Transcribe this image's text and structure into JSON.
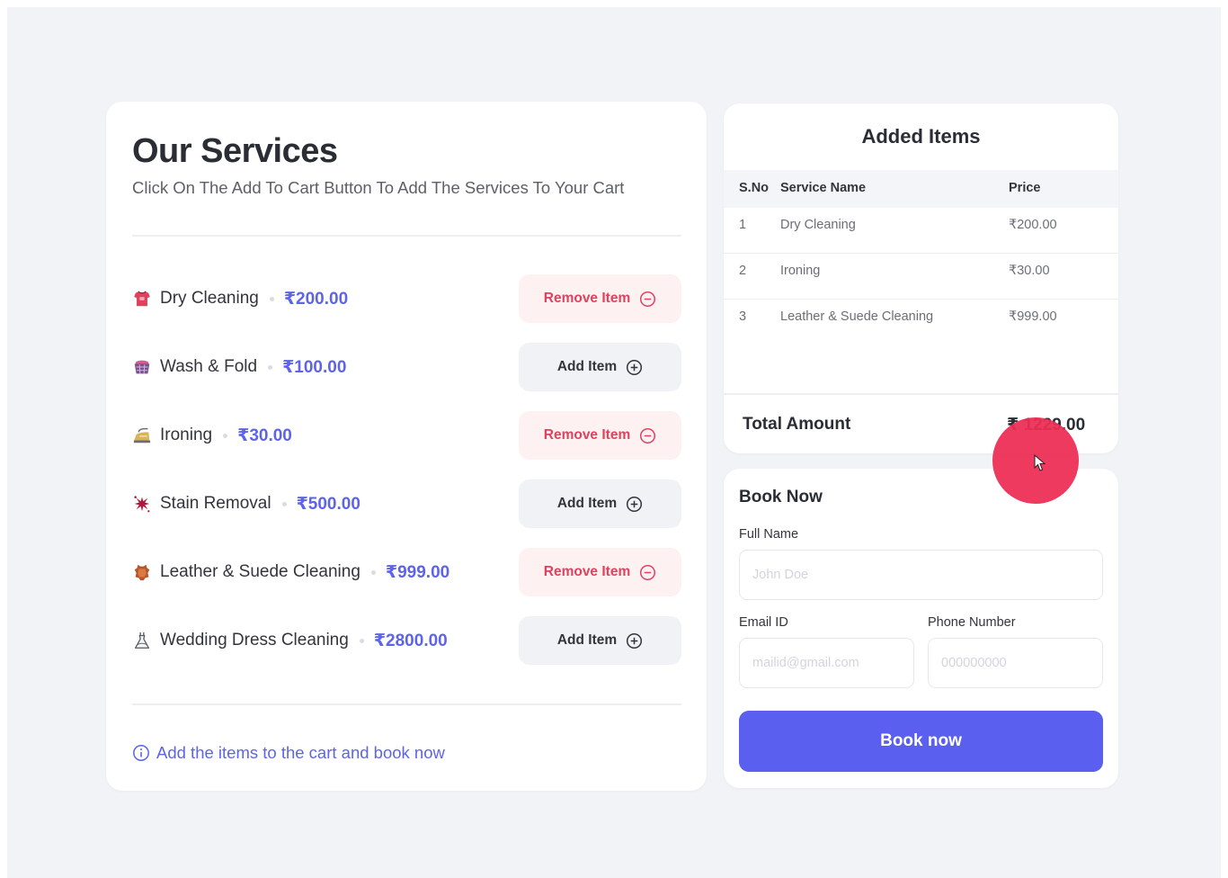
{
  "services": {
    "title": "Our Services",
    "subtitle": "Click On The Add To Cart Button To Add The Services To Your Cart",
    "items": [
      {
        "icon": "shirt-icon",
        "name": "Dry Cleaning",
        "price": "₹200.00",
        "action": "Remove Item",
        "state": "remove"
      },
      {
        "icon": "laundry-basket-icon",
        "name": "Wash & Fold",
        "price": "₹100.00",
        "action": "Add Item",
        "state": "add"
      },
      {
        "icon": "iron-icon",
        "name": "Ironing",
        "price": "₹30.00",
        "action": "Remove Item",
        "state": "remove"
      },
      {
        "icon": "stain-splat-icon",
        "name": "Stain Removal",
        "price": "₹500.00",
        "action": "Add Item",
        "state": "add"
      },
      {
        "icon": "leather-hide-icon",
        "name": "Leather & Suede Cleaning",
        "price": "₹999.00",
        "action": "Remove Item",
        "state": "remove"
      },
      {
        "icon": "wedding-dress-icon",
        "name": "Wedding Dress Cleaning",
        "price": "₹2800.00",
        "action": "Add Item",
        "state": "add"
      }
    ],
    "footer_note": "Add the items to the cart and book now"
  },
  "cart": {
    "title": "Added Items",
    "headers": {
      "sno": "S.No",
      "name": "Service Name",
      "price": "Price"
    },
    "rows": [
      {
        "sno": "1",
        "name": "Dry Cleaning",
        "price": "₹200.00"
      },
      {
        "sno": "2",
        "name": "Ironing",
        "price": "₹30.00"
      },
      {
        "sno": "3",
        "name": "Leather & Suede Cleaning",
        "price": "₹999.00"
      }
    ],
    "total_label": "Total Amount",
    "total_value": "₹ 1229.00"
  },
  "booking": {
    "title": "Book Now",
    "full_name_label": "Full Name",
    "full_name_placeholder": "John Doe",
    "email_label": "Email ID",
    "email_placeholder": "mailid@gmail.com",
    "phone_label": "Phone Number",
    "phone_placeholder": "000000000",
    "button_label": "Book now"
  },
  "colors": {
    "accent": "#5b5fef",
    "price_text": "#5d64e8",
    "remove_text": "#e0425d",
    "remove_bg": "#fdf1f1",
    "add_bg": "#f1f2f5",
    "cursor_highlight": "#ec2e54"
  }
}
